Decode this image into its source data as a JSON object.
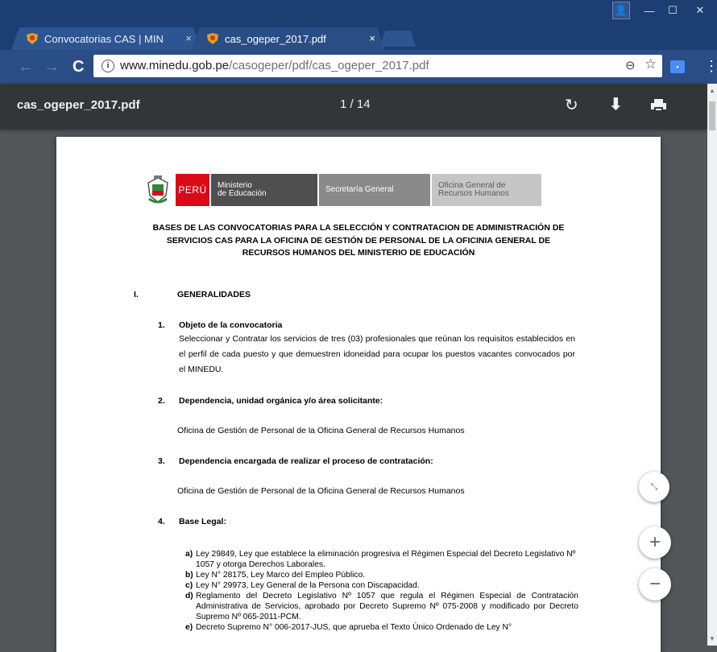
{
  "browser": {
    "tabs": [
      {
        "label": "Convocatorias CAS | MIN",
        "close": "×",
        "active": false
      },
      {
        "label": "cas_ogeper_2017.pdf",
        "close": "×",
        "active": true
      }
    ],
    "window_controls": {
      "profile": "👤",
      "minimize": "—",
      "maximize": "☐",
      "close": "✕"
    },
    "nav": {
      "back": "←",
      "forward": "→",
      "reload": "C"
    },
    "address": {
      "info": "i",
      "domain": "www.minedu.gob.pe",
      "path": "/casogeper/pdf/cas_ogeper_2017.pdf"
    },
    "icons": {
      "zoom": "⊖",
      "star": "☆",
      "extension": "▪",
      "menu": "⋮"
    }
  },
  "pdf_viewer": {
    "title": "cas_ogeper_2017.pdf",
    "page_current": "1",
    "page_separator": "/",
    "page_total": "14",
    "rotate_icon": "↻",
    "download_icon": "⬇",
    "zoom_in": "+",
    "zoom_out": "−",
    "fit": "⤡"
  },
  "document": {
    "logo": {
      "country": "PERÚ",
      "ministry_line1": "Ministerio",
      "ministry_line2": "de Educación",
      "secretary": "Secretaría General",
      "office_line1": "Oficina General de",
      "office_line2": "Recursos Humanos"
    },
    "title_lines": [
      "BASES DE LAS CONVOCATORIAS PARA LA SELECCIÓN Y CONTRATACION DE ADMINISTRACIÓN DE",
      "SERVICIOS CAS PARA LA OFICINA DE GESTIÓN DE PERSONAL DE LA OFICINIA GENERAL DE",
      "RECURSOS HUMANOS DEL  MINISTERIO DE EDUCACIÓN"
    ],
    "section_num": "I.",
    "section_title": "GENERALIDADES",
    "items": [
      {
        "num": "1.",
        "title": "Objeto de la convocatoria",
        "text": " Seleccionar y Contratar los servicios de tres (03) profesionales que reúnan los requisitos establecidos en el perfil de cada puesto y que demuestren idoneidad para ocupar los puestos vacantes convocados por el MINEDU."
      },
      {
        "num": "2.",
        "title": "Dependencia, unidad orgánica y/o área solicitante:",
        "text": "Oficina de Gestión de Personal de la Oficina General de Recursos Humanos"
      },
      {
        "num": "3.",
        "title": "Dependencia encargada de realizar el proceso de contratación:",
        "text": "Oficina de Gestión de Personal de la Oficina General de Recursos Humanos"
      },
      {
        "num": "4.",
        "title": "Base Legal:"
      }
    ],
    "legal": [
      {
        "mark": "a)",
        "text": "Ley 29849, Ley que establece la eliminación progresiva el Régimen Especial del Decreto Legislativo Nº 1057 y otorga Derechos Laborales."
      },
      {
        "mark": "b)",
        "text": "Ley N° 28175, Ley Marco del Empleo Público."
      },
      {
        "mark": "c)",
        "text": "Ley N° 29973, Ley General de la Persona con Discapacidad."
      },
      {
        "mark": "d)",
        "text": "Reglamento del Decreto Legislativo Nº 1057 que regula el Régimen Especial de Contratación Administrativa de Servicios, aprobado por Decreto Supremo Nº 075-2008 y modificado por Decreto Supremo Nº 065-2011-PCM."
      },
      {
        "mark": "e)",
        "text": "Decreto Supremo N° 006-2017-JUS, que aprueba el Texto Único Ordenado de Ley N°"
      }
    ]
  },
  "colors": {
    "tabstrip": "#1c3e72",
    "toolbar": "#2a4d86",
    "pdf_toolbar": "#323639",
    "viewer_bg": "#525659",
    "peru_red": "#d90a17"
  }
}
